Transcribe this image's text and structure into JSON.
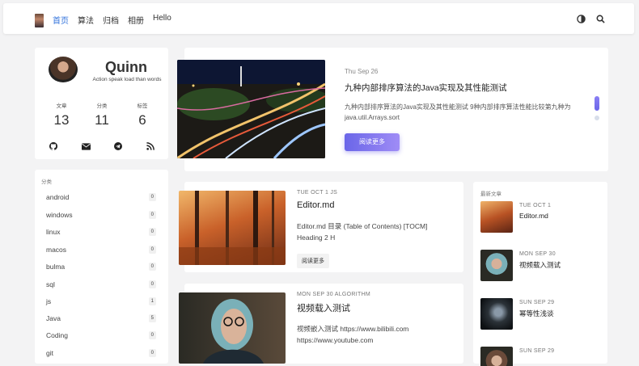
{
  "nav": {
    "items": [
      "首页",
      "算法",
      "归档",
      "相册",
      "Hello"
    ]
  },
  "profile": {
    "name": "Quinn",
    "bio": "Action speak load than words",
    "stats": [
      {
        "label": "文章",
        "value": "13"
      },
      {
        "label": "分类",
        "value": "11"
      },
      {
        "label": "标签",
        "value": "6"
      }
    ],
    "social_icons": [
      "github-icon",
      "mail-icon",
      "telegram-icon",
      "rss-icon"
    ]
  },
  "categories": {
    "heading": "分类",
    "items": [
      {
        "name": "android",
        "count": "0"
      },
      {
        "name": "windows",
        "count": "0"
      },
      {
        "name": "linux",
        "count": "0"
      },
      {
        "name": "macos",
        "count": "0"
      },
      {
        "name": "bulma",
        "count": "0"
      },
      {
        "name": "sql",
        "count": "0"
      },
      {
        "name": "js",
        "count": "1"
      },
      {
        "name": "Java",
        "count": "5"
      },
      {
        "name": "Coding",
        "count": "0"
      },
      {
        "name": "git",
        "count": "0"
      }
    ]
  },
  "hero": {
    "date": "Thu Sep 26",
    "title": "九种内部排序算法的Java实现及其性能测试",
    "excerpt": "九种内部排序算法的Java实现及其性能测试 9种内部排序算法性能比较第九种为java.util.Arrays.sort",
    "button": "阅读更多"
  },
  "posts": [
    {
      "meta": "TUE OCT 1   JS",
      "title": "Editor.md",
      "excerpt": "Editor.md 目录 (Table of Contents) [TOCM] Heading 2 H",
      "button": "阅读更多"
    },
    {
      "meta": "MON SEP 30   ALGORITHM",
      "title": "视频载入测试",
      "excerpt": "视频嵌入测试 https://www.bilibili.com https://www.youtube.com"
    }
  ],
  "recent": {
    "heading": "最新文章",
    "items": [
      {
        "date": "TUE OCT 1",
        "title": "Editor.md"
      },
      {
        "date": "MON SEP 30",
        "title": "视频载入测试"
      },
      {
        "date": "SUN SEP 29",
        "title": "幂等性浅谈"
      },
      {
        "date": "SUN SEP 29",
        "title": ""
      }
    ]
  },
  "colors": {
    "accent": "#3273dc",
    "button_gradient": [
      "#6a66e8",
      "#9f8cf6"
    ]
  }
}
